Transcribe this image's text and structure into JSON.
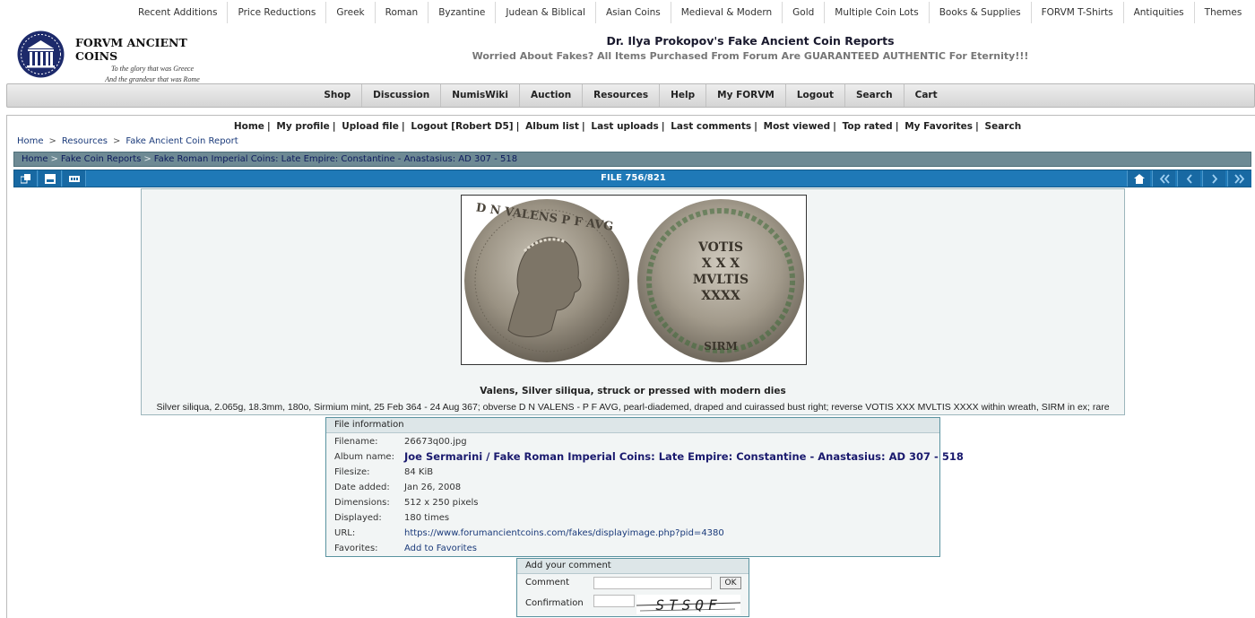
{
  "top_nav": [
    "Recent Additions",
    "Price Reductions",
    "Greek",
    "Roman",
    "Byzantine",
    "Judean & Biblical",
    "Asian Coins",
    "Medieval & Modern",
    "Gold",
    "Multiple Coin Lots",
    "Books & Supplies",
    "FORVM T-Shirts",
    "Antiquities",
    "Themes"
  ],
  "brand": {
    "name": "FORVM ANCIENT COINS",
    "tagline1": "To the glory that was Greece",
    "tagline2": "And the grandeur that was Rome"
  },
  "headline": {
    "title": "Dr. Ilya Prokopov's Fake Ancient Coin Reports",
    "subtitle": "Worried About Fakes? All Items Purchased From Forum Are GUARANTEED AUTHENTIC For Eternity!!!"
  },
  "main_nav": [
    "Shop",
    "Discussion",
    "NumisWiki",
    "Auction",
    "Resources",
    "Help",
    "My FORVM",
    "Logout",
    "Search",
    "Cart"
  ],
  "gallery_nav": [
    "Home",
    "My profile",
    "Upload file",
    "Logout [Robert D5]",
    "Album list",
    "Last uploads",
    "Last comments",
    "Most viewed",
    "Top rated",
    "My Favorites",
    "Search"
  ],
  "breadcrumb_site": [
    "Home",
    "Resources",
    "Fake Ancient Coin Report"
  ],
  "breadcrumb_gallery": [
    "Home",
    "Fake Coin Reports",
    "Fake Roman Imperial Coins: Late Empire: Constantine - Anastasius: AD 307 - 518"
  ],
  "toolbar": {
    "file_count": "FILE 756/821"
  },
  "image": {
    "reverse_legend": [
      "VOTIS",
      "X X X",
      "MVLTIS",
      "XXXX"
    ],
    "obverse_legend": "D N VALENS P F AVG",
    "mint_mark": "SIRM",
    "caption": "Valens, Silver siliqua, struck or pressed with modern dies",
    "description": "Silver siliqua, 2.065g, 18.3mm, 180o, Sirmium mint, 25 Feb 364 - 24 Aug 367; obverse D N VALENS - P F AVG, pearl-diademed, draped and cuirassed bust right; reverse VOTIS XXX MVLTIS XXXX within wreath, SIRM in ex; rare"
  },
  "file_info": {
    "heading": "File information",
    "rows": [
      {
        "label": "Filename:",
        "value": "26673q00.jpg"
      },
      {
        "label": "Album name:",
        "value": "Joe Sermarini / Fake Roman Imperial Coins: Late Empire: Constantine - Anastasius: AD 307 - 518"
      },
      {
        "label": "Filesize:",
        "value": "84 KiB"
      },
      {
        "label": "Date added:",
        "value": "Jan 26, 2008"
      },
      {
        "label": "Dimensions:",
        "value": "512 x 250 pixels"
      },
      {
        "label": "Displayed:",
        "value": "180 times"
      },
      {
        "label": "URL:",
        "value": "https://www.forumancientcoins.com/fakes/displayimage.php?pid=4380"
      },
      {
        "label": "Favorites:",
        "value": "Add to Favorites"
      }
    ]
  },
  "comment": {
    "heading": "Add your comment",
    "comment_label": "Comment",
    "confirm_label": "Confirmation",
    "ok_label": "OK",
    "captcha_text": "STSQF"
  },
  "colors": {
    "toolbar_blue": "#1f79b7",
    "breadcrumb_bar": "#6e8a94",
    "album_link": "#1a1a6e"
  }
}
